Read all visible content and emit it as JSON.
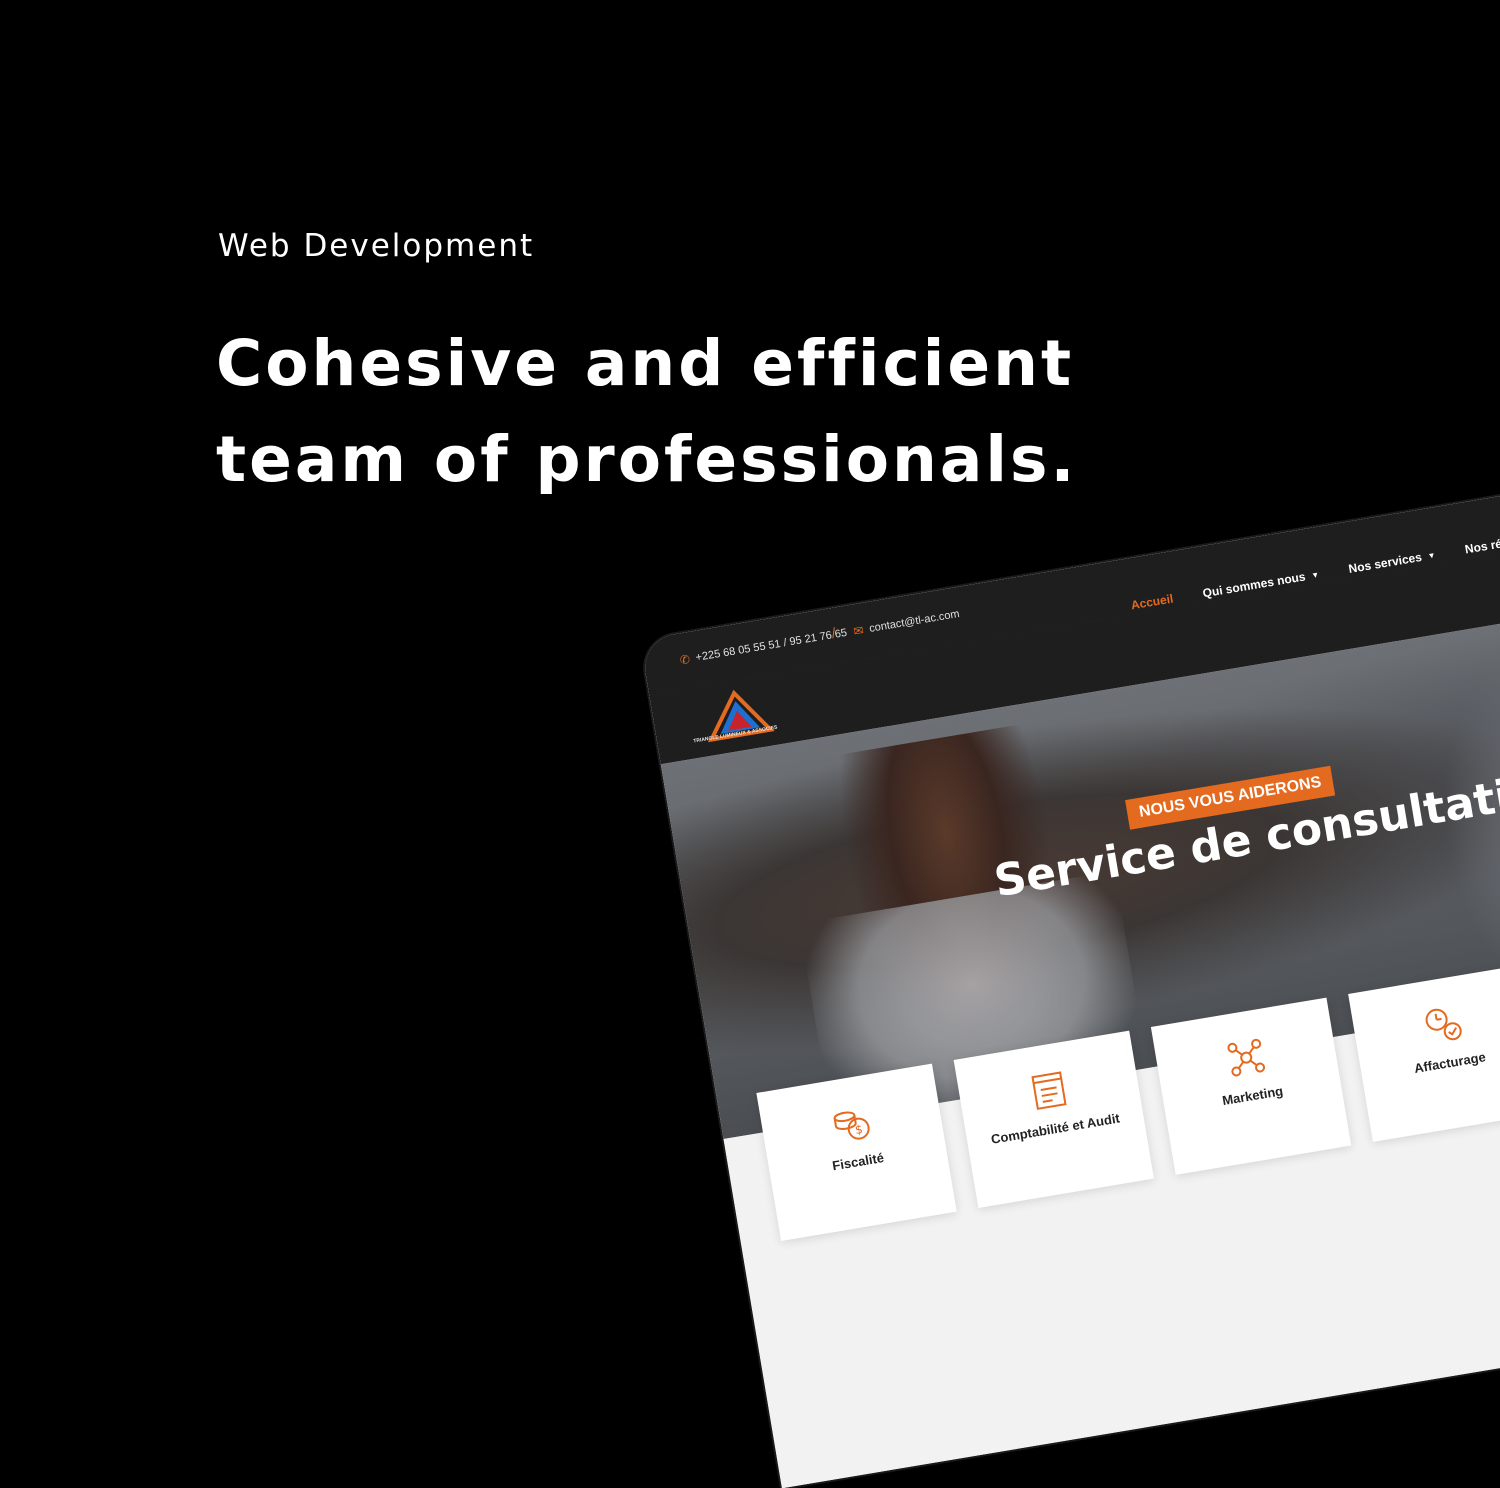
{
  "intro": {
    "category": "Web Development",
    "headline_line1": "Cohesive and efficient",
    "headline_line2": "team of professionals."
  },
  "site": {
    "phone": "+225 68 05 55 51 / 95 21 76 65",
    "email": "contact@tl-ac.com",
    "logo_text": "TRIANGLE LUMINEUX & ASSOCIES",
    "nav": [
      {
        "label": "Accueil",
        "active": true
      },
      {
        "label": "Qui sommes nous",
        "has_caret": true
      },
      {
        "label": "Nos services",
        "has_caret": true
      },
      {
        "label": "Nos réalisa"
      }
    ],
    "hero": {
      "tag": "NOUS VOUS AIDERONS",
      "title": "Service de consultation"
    },
    "services": [
      {
        "label": "Fiscalité",
        "icon": "coins-icon"
      },
      {
        "label": "Comptabilité et Audit",
        "icon": "document-icon"
      },
      {
        "label": "Marketing",
        "icon": "network-icon"
      },
      {
        "label": "Affacturage",
        "icon": "clock-icon"
      }
    ]
  },
  "colors": {
    "accent": "#e36a1e",
    "background": "#000000",
    "dark_bar": "#1e1e1e"
  }
}
